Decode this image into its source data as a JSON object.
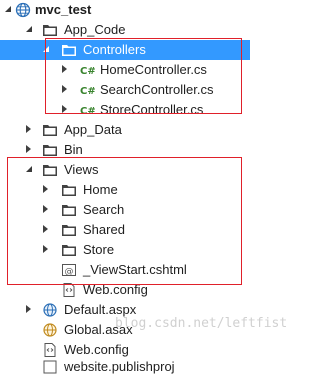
{
  "solution": {
    "name": "mvc_test"
  },
  "tree": {
    "app_code": {
      "label": "App_Code",
      "controllers": {
        "label": "Controllers",
        "files": [
          "HomeController.cs",
          "SearchController.cs",
          "StoreController.cs"
        ]
      }
    },
    "app_data": {
      "label": "App_Data"
    },
    "bin": {
      "label": "Bin"
    },
    "views": {
      "label": "Views",
      "folders": [
        "Home",
        "Search",
        "Shared",
        "Store"
      ],
      "files": [
        "_ViewStart.cshtml",
        "Web.config"
      ]
    },
    "root_files": [
      "Default.aspx",
      "Global.asax",
      "Web.config",
      "website.publishproj"
    ]
  },
  "watermark": "blog.csdn.net/leftfist",
  "colors": {
    "selection": "#3399ff",
    "highlight_box": "#e0202a",
    "folder": "#dcb967",
    "csharp": "#38832d"
  }
}
